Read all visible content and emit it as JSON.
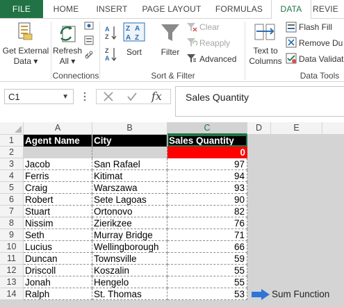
{
  "ribbon_tabs": [
    "FILE",
    "HOME",
    "INSERT",
    "PAGE LAYOUT",
    "FORMULAS",
    "DATA",
    "REVIE"
  ],
  "ribbon": {
    "get_external_data": [
      "Get External",
      "Data ▾"
    ],
    "refresh_all": [
      "Refresh",
      "All ▾"
    ],
    "connections_group": "Connections",
    "sort": "Sort",
    "filter": "Filter",
    "clear": "Clear",
    "reapply": "Reapply",
    "advanced": "Advanced",
    "sort_filter_group": "Sort & Filter",
    "text_to_columns": [
      "Text to",
      "Columns"
    ],
    "flash_fill": "Flash Fill",
    "remove_duplicates": "Remove Du",
    "data_validation": "Data Validat",
    "data_tools_group": "Data Tools",
    "colors": {
      "accent": "#217346",
      "icon_blue": "#2b6cb0"
    }
  },
  "formula_bar": {
    "name_box": "C1",
    "fx": "fx",
    "content": "Sales Quantity"
  },
  "grid": {
    "columns": [
      "A",
      "B",
      "C",
      "D",
      "E"
    ],
    "selected_column": "C",
    "rows": [
      "1",
      "2",
      "3",
      "4",
      "5",
      "6",
      "7",
      "8",
      "9",
      "10",
      "11",
      "12",
      "13",
      "14"
    ],
    "headers": [
      "Agent Name",
      "City",
      "Sales Quantity"
    ],
    "total_cell": "0",
    "records": [
      [
        "Jacob",
        "San Rafael",
        "97"
      ],
      [
        "Ferris",
        "Kitimat",
        "94"
      ],
      [
        "Craig",
        "Warszawa",
        "93"
      ],
      [
        "Robert",
        "Sete Lagoas",
        "90"
      ],
      [
        "Stuart",
        "Ortonovo",
        "82"
      ],
      [
        "Nissim",
        "Zierikzee",
        "76"
      ],
      [
        "Seth",
        "Murray Bridge",
        "71"
      ],
      [
        "Lucius",
        "Wellingborough",
        "66"
      ],
      [
        "Duncan",
        "Townsville",
        "59"
      ],
      [
        "Driscoll",
        "Koszalin",
        "55"
      ],
      [
        "Jonah",
        "Hengelo",
        "55"
      ],
      [
        "Ralph",
        "St. Thomas",
        "53"
      ]
    ],
    "annotation": "Sum Function",
    "colors": {
      "header_bg": "#000000",
      "total_bg": "#ff0000",
      "arrow": "#2e75d6"
    }
  }
}
